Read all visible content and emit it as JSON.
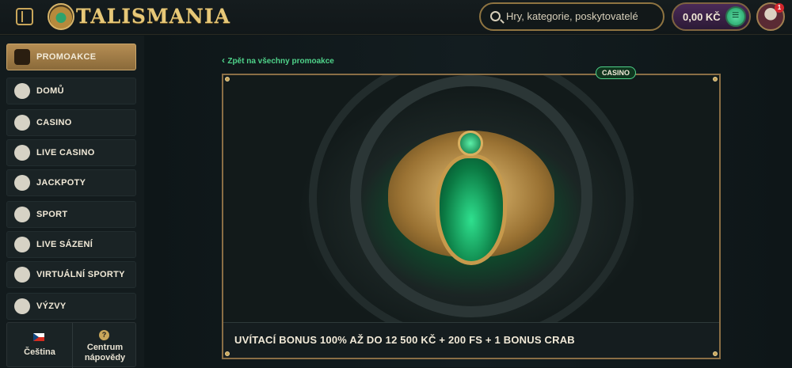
{
  "header": {
    "logo_text": "TALISMANIA",
    "search_placeholder": "Hry, kategorie, poskytovatelé",
    "balance": "0,00 KČ",
    "notification_count": "1"
  },
  "sidebar": {
    "items": [
      {
        "label": "PROMOAKCE",
        "icon": "gift-icon",
        "active": true
      },
      {
        "label": "DOMŮ",
        "icon": "home-icon"
      },
      {
        "label": "CASINO",
        "icon": "casino-chip-icon"
      },
      {
        "label": "LIVE CASINO",
        "icon": "spade-icon"
      },
      {
        "label": "JACKPOTY",
        "icon": "clover-icon"
      },
      {
        "label": "SPORT",
        "icon": "soccer-ball-icon"
      },
      {
        "label": "LIVE SÁZENÍ",
        "icon": "play-icon"
      },
      {
        "label": "VIRTUÁLNÍ SPORTY",
        "icon": "gamepad-icon"
      },
      {
        "label": "VÝZVY",
        "icon": "trophy-icon"
      }
    ],
    "footer": {
      "language": "Čeština",
      "help_line1": "Centrum",
      "help_line2": "nápovědy",
      "help_icon": "?"
    }
  },
  "main": {
    "back_link": "Zpět na všechny promoakce",
    "banner_tag": "CASINO",
    "banner_caption": "UVÍTACÍ BONUS 100% AŽ DO 12 500 KČ + 200 FS + 1 BONUS CRAB"
  },
  "colors": {
    "accent_gold": "#c9a65a",
    "accent_green": "#4fd38a",
    "background": "#0f1719"
  }
}
